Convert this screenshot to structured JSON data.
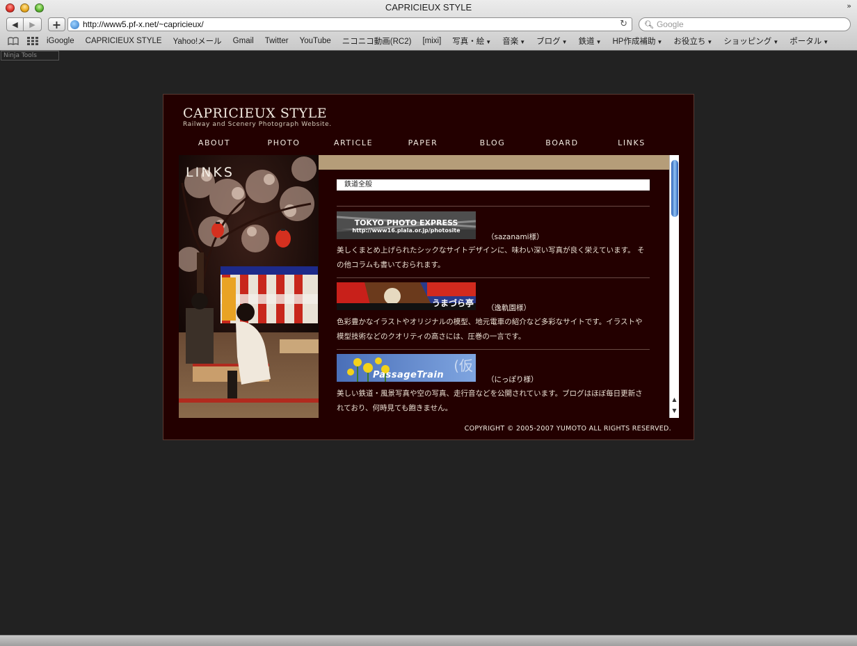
{
  "browser": {
    "window_title": "CAPRICIEUX STYLE",
    "url": "http://www5.pf-x.net/~capricieux/",
    "search_placeholder": "Google",
    "bookmarks": [
      {
        "label": "iGoogle",
        "menu": false
      },
      {
        "label": "CAPRICIEUX STYLE",
        "menu": false
      },
      {
        "label": "Yahoo!メール",
        "menu": false
      },
      {
        "label": "Gmail",
        "menu": false
      },
      {
        "label": "Twitter",
        "menu": false
      },
      {
        "label": "YouTube",
        "menu": false
      },
      {
        "label": "ニコニコ動画(RC2)",
        "menu": false
      },
      {
        "label": "[mixi]",
        "menu": false
      },
      {
        "label": "写真・絵",
        "menu": true
      },
      {
        "label": "音楽",
        "menu": true
      },
      {
        "label": "ブログ",
        "menu": true
      },
      {
        "label": "鉄道",
        "menu": true
      },
      {
        "label": "HP作成補助",
        "menu": true
      },
      {
        "label": "お役立ち",
        "menu": true
      },
      {
        "label": "ショッピング",
        "menu": true
      },
      {
        "label": "ポータル",
        "menu": true
      }
    ],
    "ninja_tools_label": "Ninja Tools"
  },
  "site": {
    "logo": "CAPRICIEUX STYLE",
    "tagline": "Railway and Scenery Photograph Website.",
    "nav": [
      "ABOUT",
      "PHOTO",
      "ARTICLE",
      "PAPER",
      "BLOG",
      "BOARD",
      "LINKS"
    ],
    "section_label": "LINKS",
    "category": "鉄道全般",
    "links": [
      {
        "banner_text_1": "TOKYO PHOTO EXPRESS",
        "banner_text_2": "http://www16.plala.or.jp/photosite",
        "owner": "（sazanami様）",
        "desc": "美しくまとめ上げられたシックなサイトデザインに、味わい深い写真が良く栄えています。 その他コラムも書いておられます。"
      },
      {
        "banner_text_1": "うまづら亭",
        "banner_text_2": "",
        "owner": "（逸軌園様）",
        "desc": "色彩豊かなイラストやオリジナルの模型、地元電車の紹介など多彩なサイトです。イラストや模型技術などのクオリティの高さには、圧巻の一言です。"
      },
      {
        "banner_text_1": "PassageTrain",
        "banner_text_2": "(仮",
        "owner": "（にっぽり様）",
        "desc": "美しい鉄道・風景写真や空の写真、走行音などを公開されています。ブログはほぼ毎日更新されており、何時見ても飽きません。"
      }
    ],
    "copyright": "COPYRIGHT © 2005-2007 YUMOTO ALL RIGHTS RESERVED."
  },
  "colors": {
    "page_bg": "#222222",
    "site_bg": "#230000",
    "band": "#b59d79",
    "text": "#f1eae0"
  }
}
